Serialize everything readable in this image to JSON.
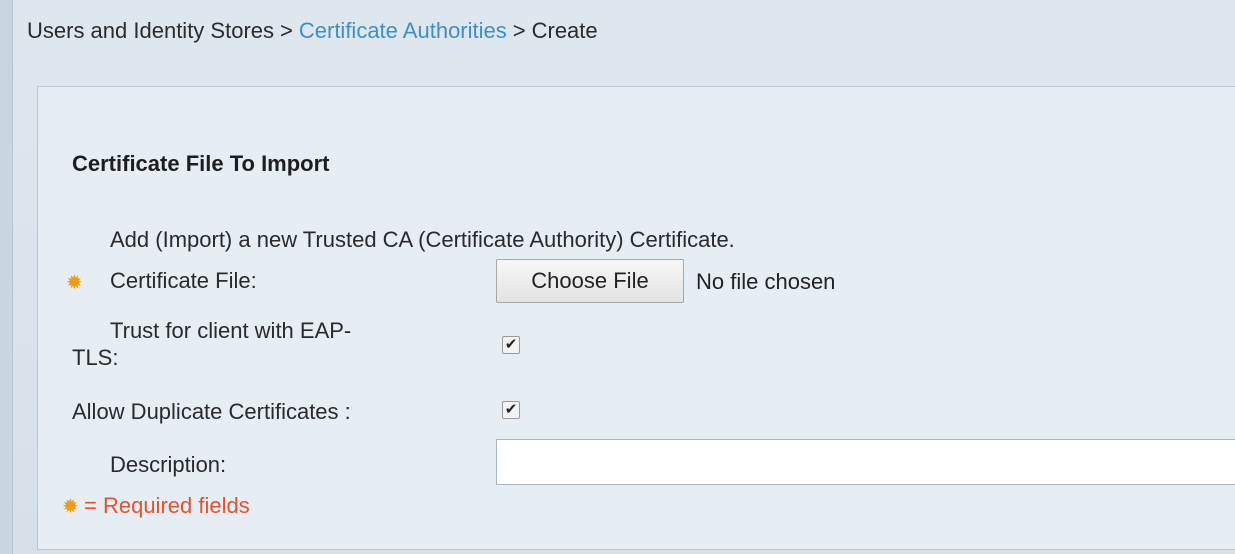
{
  "breadcrumb": {
    "items": [
      "Users and Identity Stores",
      "Certificate Authorities",
      "Create"
    ],
    "separator": ">"
  },
  "section": {
    "title": "Certificate File To Import",
    "intro": "Add (Import) a new Trusted CA (Certificate Authority) Certificate."
  },
  "form": {
    "certificate_file": {
      "label": "Certificate File:",
      "button_label": "Choose File",
      "status": "No file chosen",
      "required": true
    },
    "trust_eap_tls": {
      "label_line1": "Trust for client with EAP-",
      "label_line2": "TLS:",
      "checked": true
    },
    "allow_duplicates": {
      "label": "Allow Duplicate Certificates :",
      "checked": true
    },
    "description": {
      "label": "Description:",
      "value": ""
    }
  },
  "footer": {
    "required_note": "= Required fields"
  },
  "colors": {
    "link": "#3f8fc6",
    "required_icon": "#f09a16",
    "required_text": "#e2542f"
  },
  "icons": {
    "required": "gear-asterisk-icon",
    "checkmark": "checkmark-icon"
  }
}
